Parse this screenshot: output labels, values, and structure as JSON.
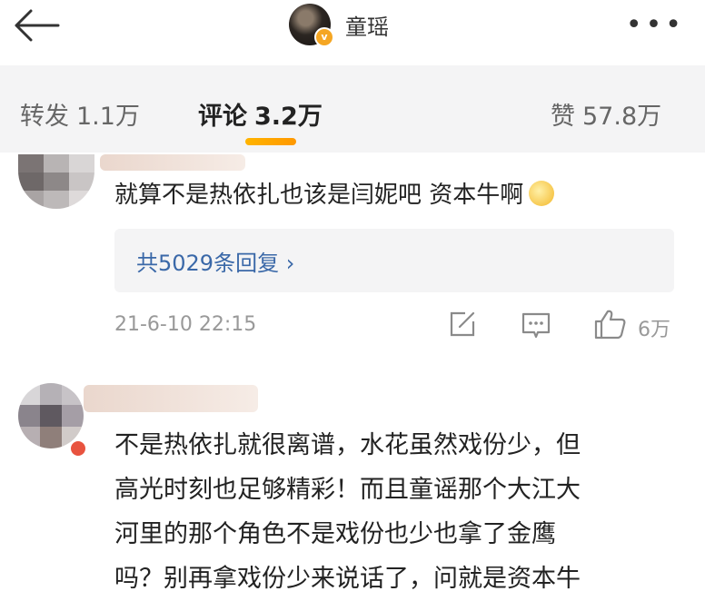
{
  "header": {
    "profile_name": "童瑶",
    "verified_badge": "v",
    "more_label": "•••"
  },
  "tabs": [
    {
      "label": "转发",
      "count": "1.1万"
    },
    {
      "label": "评论",
      "count": "3.2万"
    },
    {
      "label": "赞",
      "count": "57.8万"
    }
  ],
  "active_tab": "评论",
  "accent_color": "#ffb400",
  "link_color": "#3a68a8",
  "comments": [
    {
      "text": "就算不是热依扎也该是闫妮吧 资本牛啊",
      "emoji": "drooling-face-emoji",
      "replies_label": "共5029条回复",
      "timestamp": "21-6-10 22:15",
      "like_count": "6万"
    },
    {
      "text_lines": [
        "不是热依扎就很离谱，水花虽然戏份少，但",
        "高光时刻也足够精彩！而且童谣那个大江大",
        "河里的那个角色不是戏份也少也拿了金鹰",
        "吗？别再拿戏份少来说话了，问就是资本牛"
      ]
    }
  ]
}
